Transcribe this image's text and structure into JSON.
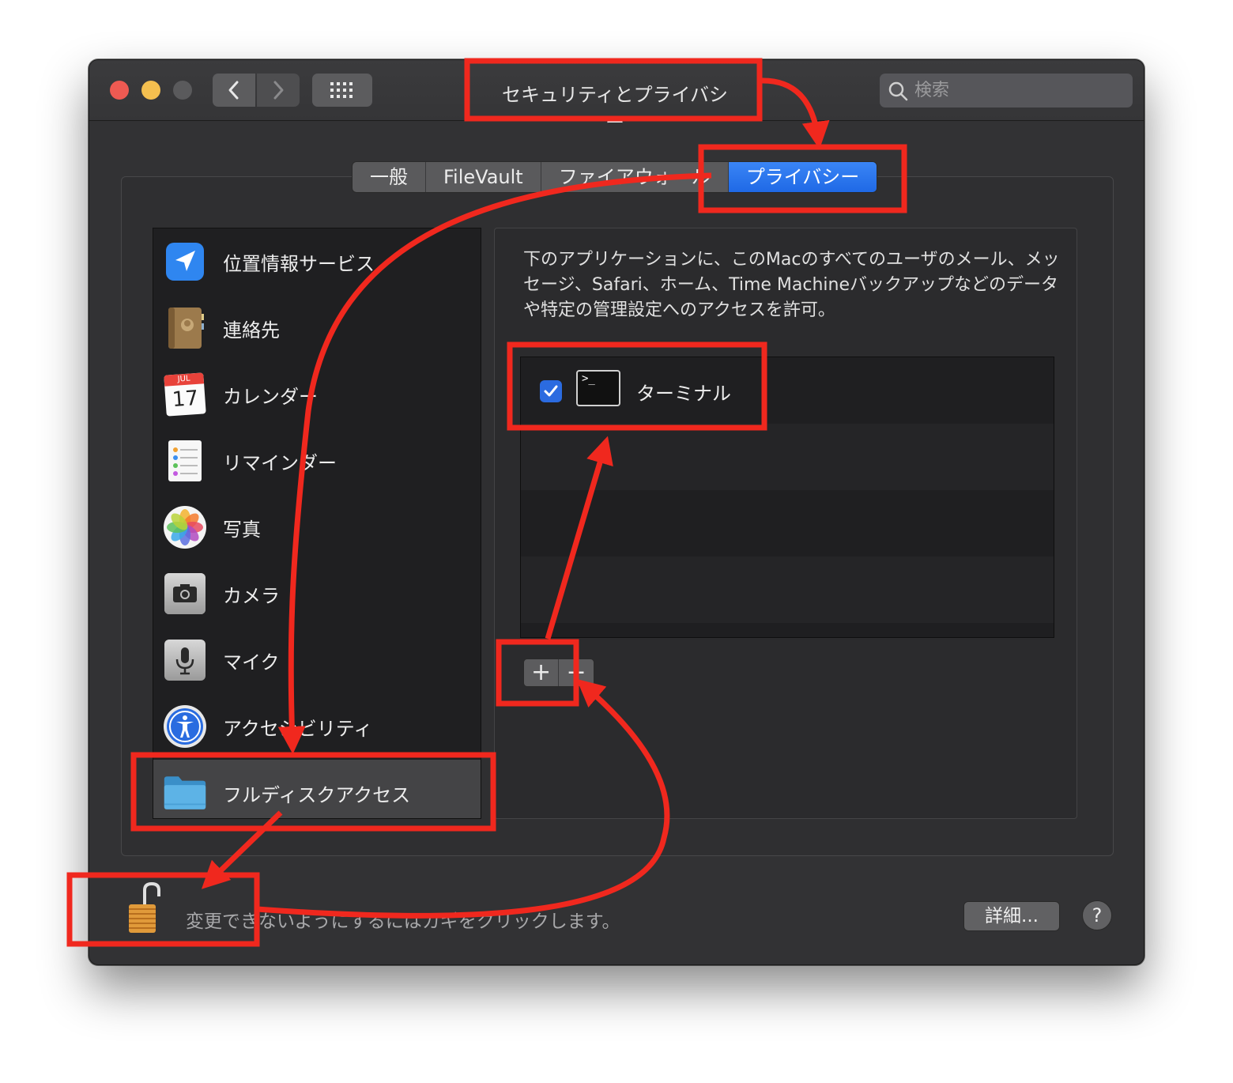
{
  "window": {
    "title": "セキュリティとプライバシー",
    "search_placeholder": "検索"
  },
  "tabs": [
    {
      "label": "一般"
    },
    {
      "label": "FileVault"
    },
    {
      "label": "ファイアウォール"
    },
    {
      "label": "プライバシー",
      "active": true
    }
  ],
  "sidebar": {
    "items": [
      {
        "label": "位置情報サービス",
        "icon": "location-arrow-icon"
      },
      {
        "label": "連絡先",
        "icon": "contacts-icon"
      },
      {
        "label": "カレンダー",
        "icon": "calendar-icon",
        "icon_month": "JUL",
        "icon_day": "17"
      },
      {
        "label": "リマインダー",
        "icon": "reminders-icon"
      },
      {
        "label": "写真",
        "icon": "photos-icon"
      },
      {
        "label": "カメラ",
        "icon": "camera-icon"
      },
      {
        "label": "マイク",
        "icon": "microphone-icon"
      },
      {
        "label": "アクセシビリティ",
        "icon": "accessibility-icon"
      },
      {
        "label": "フルディスクアクセス",
        "icon": "folder-icon",
        "selected": true
      }
    ]
  },
  "main": {
    "description": "下のアプリケーションに、このMacのすべてのユーザのメール、メッセージ、Safari、ホーム、Time Machineバックアップなどのデータや特定の管理設定へのアクセスを許可。",
    "apps": [
      {
        "name": "ターミナル",
        "checked": true,
        "icon": "terminal-icon",
        "icon_glyph": ">_"
      }
    ],
    "add_label": "+",
    "remove_label": "−"
  },
  "footer": {
    "lock_text": "変更できないようにするにはカギをクリックします。",
    "details_label": "詳細...",
    "help_label": "?"
  },
  "colors": {
    "annotation": "#f0281e",
    "accent": "#2b6be0"
  }
}
